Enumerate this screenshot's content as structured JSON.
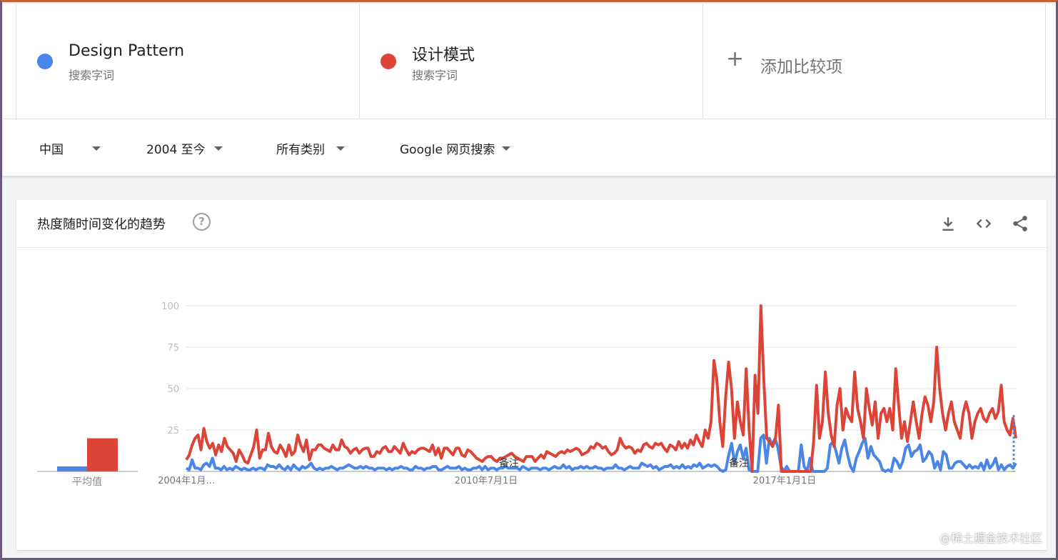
{
  "terms": [
    {
      "name": "Design Pattern",
      "sub": "搜索字词",
      "color": "#4a86e8"
    },
    {
      "name": "设计模式",
      "sub": "搜索字词",
      "color": "#db4437"
    }
  ],
  "add_term": {
    "label": "添加比较项"
  },
  "filters": {
    "region": "中国",
    "time": "2004 至今",
    "category": "所有类别",
    "property": "Google 网页搜索"
  },
  "card": {
    "title": "热度随时间变化的趋势",
    "avg_label": "平均值",
    "note_label": "备注"
  },
  "watermark": "@稀土掘金技术社区",
  "chart_data": {
    "type": "line",
    "x_ticks": [
      "2004年1月...",
      "2010年7月1日",
      "2017年1月1日"
    ],
    "ylim": [
      0,
      100
    ],
    "y_ticks": [
      25,
      50,
      75,
      100
    ],
    "grid": true,
    "averages": [
      {
        "name": "Design Pattern",
        "value": 3
      },
      {
        "name": "设计模式",
        "value": 20
      }
    ],
    "series": [
      {
        "name": "Design Pattern",
        "color": "#4a86e8",
        "values": [
          2,
          1,
          7,
          2,
          2,
          1,
          4,
          5,
          3,
          8,
          2,
          2,
          1,
          3,
          1,
          2,
          1,
          3,
          2,
          1,
          2,
          1,
          1,
          2,
          1,
          2,
          2,
          1,
          4,
          3,
          3,
          2,
          4,
          2,
          1,
          3,
          1,
          4,
          2,
          1,
          3,
          2,
          3,
          5,
          2,
          1,
          2,
          1,
          2,
          2,
          3,
          2,
          1,
          2,
          2,
          3,
          4,
          3,
          2,
          2,
          3,
          2,
          3,
          2,
          2,
          1,
          2,
          2,
          2,
          1,
          2,
          1,
          2,
          2,
          3,
          2,
          2,
          1,
          1,
          3,
          2,
          2,
          1,
          2,
          2,
          3,
          3,
          1,
          1,
          2,
          3,
          2,
          2,
          2,
          3,
          1,
          2,
          1,
          1,
          2,
          2,
          3,
          1,
          3,
          1,
          2,
          2,
          1,
          2,
          2,
          3,
          2,
          2,
          2,
          2,
          1,
          3,
          2,
          1,
          2,
          2,
          2,
          1,
          2,
          2,
          1,
          2,
          3,
          2,
          2,
          4,
          2,
          3,
          1,
          2,
          2,
          3,
          2,
          3,
          2,
          2,
          3,
          2,
          2,
          1,
          2,
          2,
          2,
          4,
          2,
          2,
          1,
          2,
          3,
          2,
          2,
          2,
          5,
          4,
          3,
          4,
          2,
          3,
          1,
          2,
          3,
          3,
          4,
          2,
          3,
          2,
          4,
          2,
          3,
          2,
          4,
          3,
          5,
          2,
          3,
          4,
          3,
          4,
          3,
          1,
          0,
          1,
          10,
          17,
          5,
          12,
          16,
          8,
          14,
          1,
          0,
          0,
          0,
          20,
          22,
          5,
          20,
          16,
          20,
          14,
          3,
          0,
          3,
          0,
          0,
          0,
          0,
          16,
          3,
          0,
          8,
          0,
          0,
          0,
          0,
          0,
          2,
          16,
          18,
          12,
          5,
          14,
          19,
          10,
          3,
          0,
          8,
          12,
          17,
          20,
          8,
          15,
          10,
          8,
          6,
          1,
          0,
          1,
          0,
          8,
          6,
          2,
          6,
          14,
          16,
          9,
          12,
          13,
          16,
          6,
          8,
          12,
          10,
          2,
          6,
          1,
          12,
          10,
          2,
          2,
          5,
          6,
          6,
          4,
          2,
          4,
          2,
          3,
          2,
          5,
          1,
          7,
          2,
          4,
          8,
          1,
          4,
          1,
          3,
          4,
          2,
          5
        ]
      },
      {
        "name": "设计模式",
        "color": "#db4437",
        "values": [
          7,
          10,
          16,
          20,
          22,
          13,
          26,
          18,
          14,
          17,
          10,
          16,
          12,
          20,
          15,
          13,
          11,
          6,
          13,
          10,
          6,
          5,
          10,
          15,
          25,
          8,
          13,
          13,
          23,
          15,
          12,
          11,
          16,
          13,
          9,
          16,
          10,
          12,
          22,
          16,
          12,
          19,
          7,
          13,
          13,
          16,
          16,
          14,
          13,
          12,
          16,
          13,
          13,
          19,
          15,
          14,
          11,
          13,
          14,
          11,
          13,
          14,
          14,
          9,
          9,
          12,
          11,
          14,
          15,
          12,
          12,
          15,
          13,
          11,
          17,
          13,
          10,
          12,
          11,
          13,
          14,
          14,
          13,
          12,
          16,
          10,
          14,
          8,
          14,
          14,
          12,
          10,
          14,
          14,
          10,
          9,
          13,
          12,
          10,
          8,
          7,
          6,
          8,
          9,
          9,
          7,
          6,
          8,
          8,
          9,
          10,
          11,
          9,
          8,
          7,
          6,
          9,
          9,
          9,
          6,
          8,
          10,
          8,
          12,
          11,
          10,
          9,
          11,
          12,
          11,
          13,
          12,
          13,
          14,
          13,
          10,
          11,
          12,
          15,
          14,
          17,
          16,
          14,
          15,
          12,
          10,
          11,
          13,
          20,
          16,
          14,
          15,
          14,
          11,
          13,
          12,
          16,
          17,
          15,
          14,
          17,
          16,
          17,
          14,
          12,
          16,
          15,
          13,
          18,
          14,
          17,
          14,
          19,
          16,
          22,
          18,
          15,
          25,
          20,
          30,
          67,
          55,
          30,
          15,
          45,
          66,
          50,
          20,
          42,
          30,
          22,
          62,
          25,
          0,
          58,
          35,
          100,
          55,
          20,
          18,
          15,
          20,
          40,
          0,
          0,
          0,
          0,
          0,
          0,
          0,
          0,
          0,
          0,
          0,
          18,
          52,
          20,
          30,
          60,
          35,
          22,
          15,
          40,
          50,
          25,
          38,
          33,
          30,
          60,
          38,
          30,
          20,
          50,
          38,
          28,
          42,
          20,
          35,
          38,
          30,
          38,
          25,
          62,
          40,
          20,
          30,
          18,
          30,
          42,
          30,
          20,
          35,
          45,
          40,
          30,
          42,
          75,
          50,
          35,
          25,
          35,
          42,
          30,
          25,
          20,
          35,
          42,
          35,
          20,
          30,
          35,
          38,
          32,
          30,
          35,
          38,
          32,
          36,
          52,
          30,
          25,
          22,
          32,
          20
        ]
      }
    ]
  }
}
